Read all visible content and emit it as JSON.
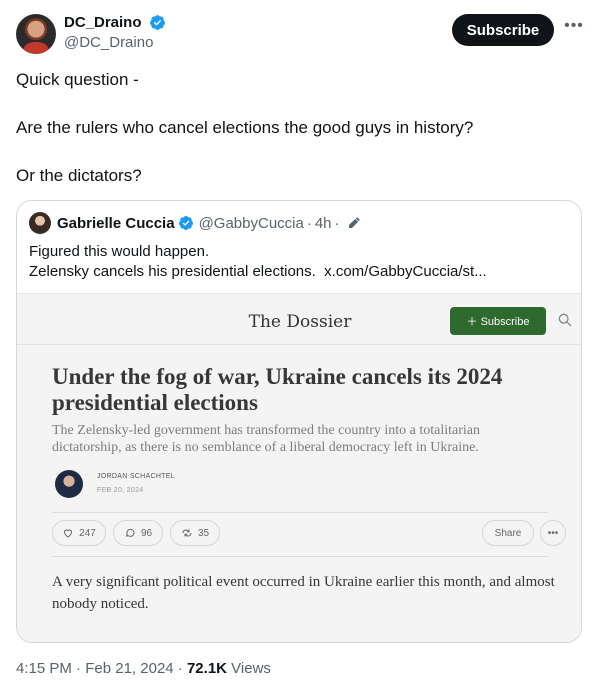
{
  "author": {
    "display_name": "DC_Draino",
    "handle": "@DC_Draino",
    "subscribe_label": "Subscribe"
  },
  "tweet": {
    "lines": [
      "Quick question -",
      "Are the rulers who cancel elections the good guys in history?",
      "Or the dictators?"
    ]
  },
  "quote": {
    "display_name": "Gabrielle Cuccia",
    "handle": "@GabbyCuccia",
    "time": "4h",
    "line1": "Figured this would happen.",
    "line2": "Zelensky cancels his presidential elections.",
    "link": "x.com/GabbyCuccia/st..."
  },
  "preview": {
    "publication": "The Dossier",
    "subscribe_label": "Subscribe",
    "headline": "Under the fog of war, Ukraine cancels its 2024 presidential elections",
    "subtitle": "The Zelensky-led government has transformed the country into a totalitarian dictatorship, as there is no semblance of a liberal democracy left in Ukraine.",
    "author_name": "JORDAN SCHACHTEL",
    "date": "FEB 20, 2024",
    "likes": "247",
    "comments": "96",
    "restacks": "35",
    "share_label": "Share",
    "body": "A very significant political event occurred in Ukraine earlier this month, and almost nobody noticed."
  },
  "meta": {
    "time": "4:15 PM",
    "date": "Feb 21, 2024",
    "views_count": "72.1K",
    "views_label": "Views"
  },
  "colors": {
    "verified": "#1d9bf0",
    "subscribe_bg": "#0f1419",
    "substack_green": "#2e6a2e"
  }
}
